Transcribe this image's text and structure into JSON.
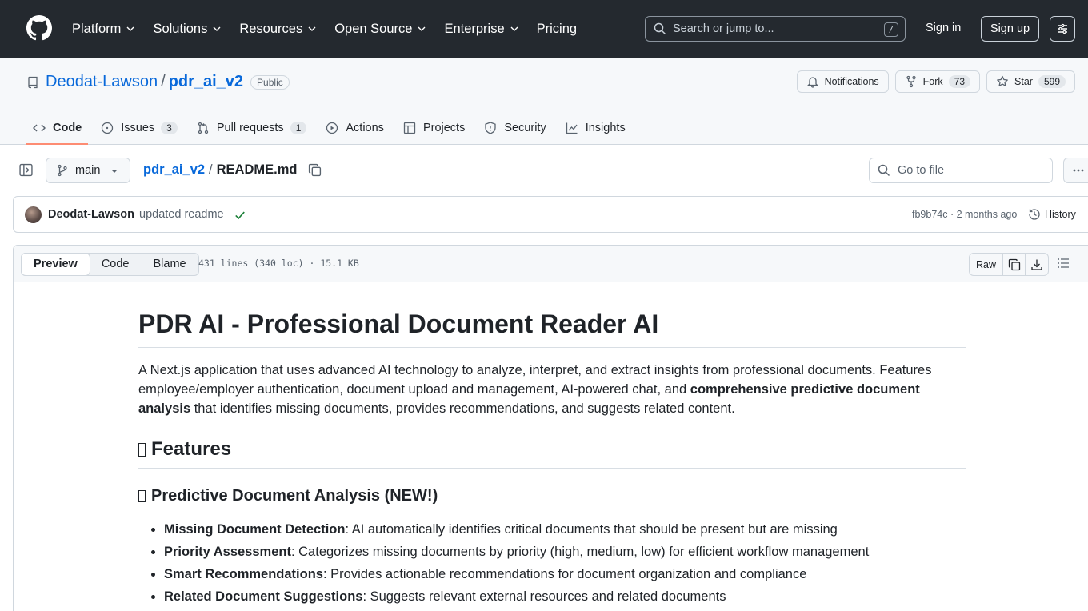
{
  "header": {
    "nav": [
      "Platform",
      "Solutions",
      "Resources",
      "Open Source",
      "Enterprise",
      "Pricing"
    ],
    "search_placeholder": "Search or jump to...",
    "search_shortcut": "/",
    "signin": "Sign in",
    "signup": "Sign up"
  },
  "repo": {
    "owner": "Deodat-Lawson",
    "separator": "/",
    "name": "pdr_ai_v2",
    "visibility": "Public",
    "notifications": "Notifications",
    "fork_label": "Fork",
    "fork_count": "73",
    "star_label": "Star",
    "star_count": "599"
  },
  "tabs": [
    {
      "label": "Code",
      "count": ""
    },
    {
      "label": "Issues",
      "count": "3"
    },
    {
      "label": "Pull requests",
      "count": "1"
    },
    {
      "label": "Actions",
      "count": ""
    },
    {
      "label": "Projects",
      "count": ""
    },
    {
      "label": "Security",
      "count": ""
    },
    {
      "label": "Insights",
      "count": ""
    }
  ],
  "file_nav": {
    "branch": "main",
    "repo_link": "pdr_ai_v2",
    "separator": "/",
    "file": "README.md",
    "goto_placeholder": "Go to file"
  },
  "commit": {
    "author": "Deodat-Lawson",
    "message": "updated readme",
    "meta": "fb9b74c · 2 months ago",
    "history": "History"
  },
  "file_view": {
    "modes": [
      "Preview",
      "Code",
      "Blame"
    ],
    "stats": "431 lines (340 loc) · 15.1 KB",
    "raw": "Raw"
  },
  "readme": {
    "title": "PDR AI - Professional Document Reader AI",
    "intro_before": "A Next.js application that uses advanced AI technology to analyze, interpret, and extract insights from professional documents. Features employee/employer authentication, document upload and management, AI-powered chat, and ",
    "intro_bold": "comprehensive predictive document analysis",
    "intro_after": " that identifies missing documents, provides recommendations, and suggests related content.",
    "h2": "Features",
    "h3": "Predictive Document Analysis (NEW!)",
    "features": [
      {
        "bold": "Missing Document Detection",
        "text": ": AI automatically identifies critical documents that should be present but are missing"
      },
      {
        "bold": "Priority Assessment",
        "text": ": Categorizes missing documents by priority (high, medium, low) for efficient workflow management"
      },
      {
        "bold": "Smart Recommendations",
        "text": ": Provides actionable recommendations for document organization and compliance"
      },
      {
        "bold": "Related Document Suggestions",
        "text": ": Suggests relevant external resources and related documents"
      }
    ]
  },
  "icons": {
    "logo": "github-logo-icon",
    "success": "#1a7f37",
    "accent": "#0969da",
    "tab_underline": "#fd8c73"
  }
}
